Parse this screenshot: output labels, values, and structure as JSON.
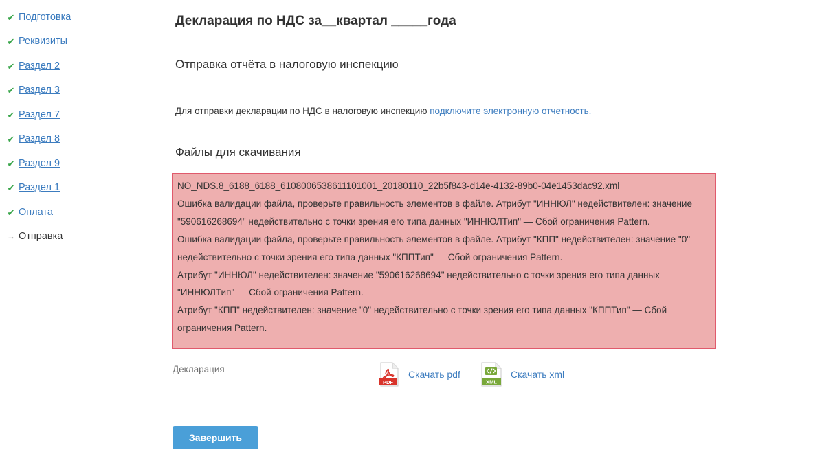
{
  "sidebar": {
    "items": [
      {
        "label": "Подготовка",
        "state": "done"
      },
      {
        "label": "Реквизиты",
        "state": "done"
      },
      {
        "label": "Раздел 2",
        "state": "done"
      },
      {
        "label": "Раздел 3",
        "state": "done"
      },
      {
        "label": "Раздел 7",
        "state": "done"
      },
      {
        "label": "Раздел 8",
        "state": "done"
      },
      {
        "label": "Раздел 9",
        "state": "done"
      },
      {
        "label": "Раздел 1",
        "state": "done"
      },
      {
        "label": "Оплата",
        "state": "done"
      },
      {
        "label": "Отправка",
        "state": "current"
      }
    ],
    "icons": {
      "done": "check-icon",
      "current": "arrow-right-icon"
    }
  },
  "main": {
    "title": "Декларация по НДС за__квартал _____года",
    "subtitle": "Отправка отчёта в налоговую инспекцию",
    "notice": {
      "text": "Для отправки декларации по НДС в налоговую инспекцию ",
      "link": "подключите электронную отчетность."
    },
    "files_heading": "Файлы для скачивания",
    "error": {
      "filename": "NO_NDS.8_6188_6188_6108006538611101001_20180110_22b5f843-d14e-4132-89b0-04e1453dac92.xml",
      "messages": [
        "Ошибка валидации файла, проверьте правильность элементов в файле. Атрибут \"ИННЮЛ\" недействителен: значение \"590616268694\" недействительно с точки зрения его типа данных \"ИННЮЛТип\" — Сбой ограничения Pattern.",
        "Ошибка валидации файла, проверьте правильность элементов в файле. Атрибут \"КПП\" недействителен: значение \"0\" недействительно с точки зрения его типа данных \"КППТип\" — Сбой ограничения Pattern.",
        "Атрибут \"ИННЮЛ\" недействителен: значение \"590616268694\" недействительно с точки зрения его типа данных \"ИННЮЛТип\" — Сбой ограничения Pattern.",
        "Атрибут \"КПП\" недействителен: значение \"0\" недействительно с точки зрения его типа данных \"КППТип\" — Сбой ограничения Pattern."
      ],
      "colors": {
        "background": "#eeafaf",
        "border": "#e05a6c"
      }
    },
    "downloads": {
      "label": "Декларация",
      "pdf": {
        "label": "Скачать pdf",
        "icon": "pdf-file-icon",
        "badge": "PDF"
      },
      "xml": {
        "label": "Скачать xml",
        "icon": "xml-file-icon",
        "badge": "XML"
      }
    },
    "finish_button": "Завершить"
  },
  "colors": {
    "link": "#3c7cbf",
    "check": "#3aa64b",
    "button": "#4a9fd8"
  }
}
